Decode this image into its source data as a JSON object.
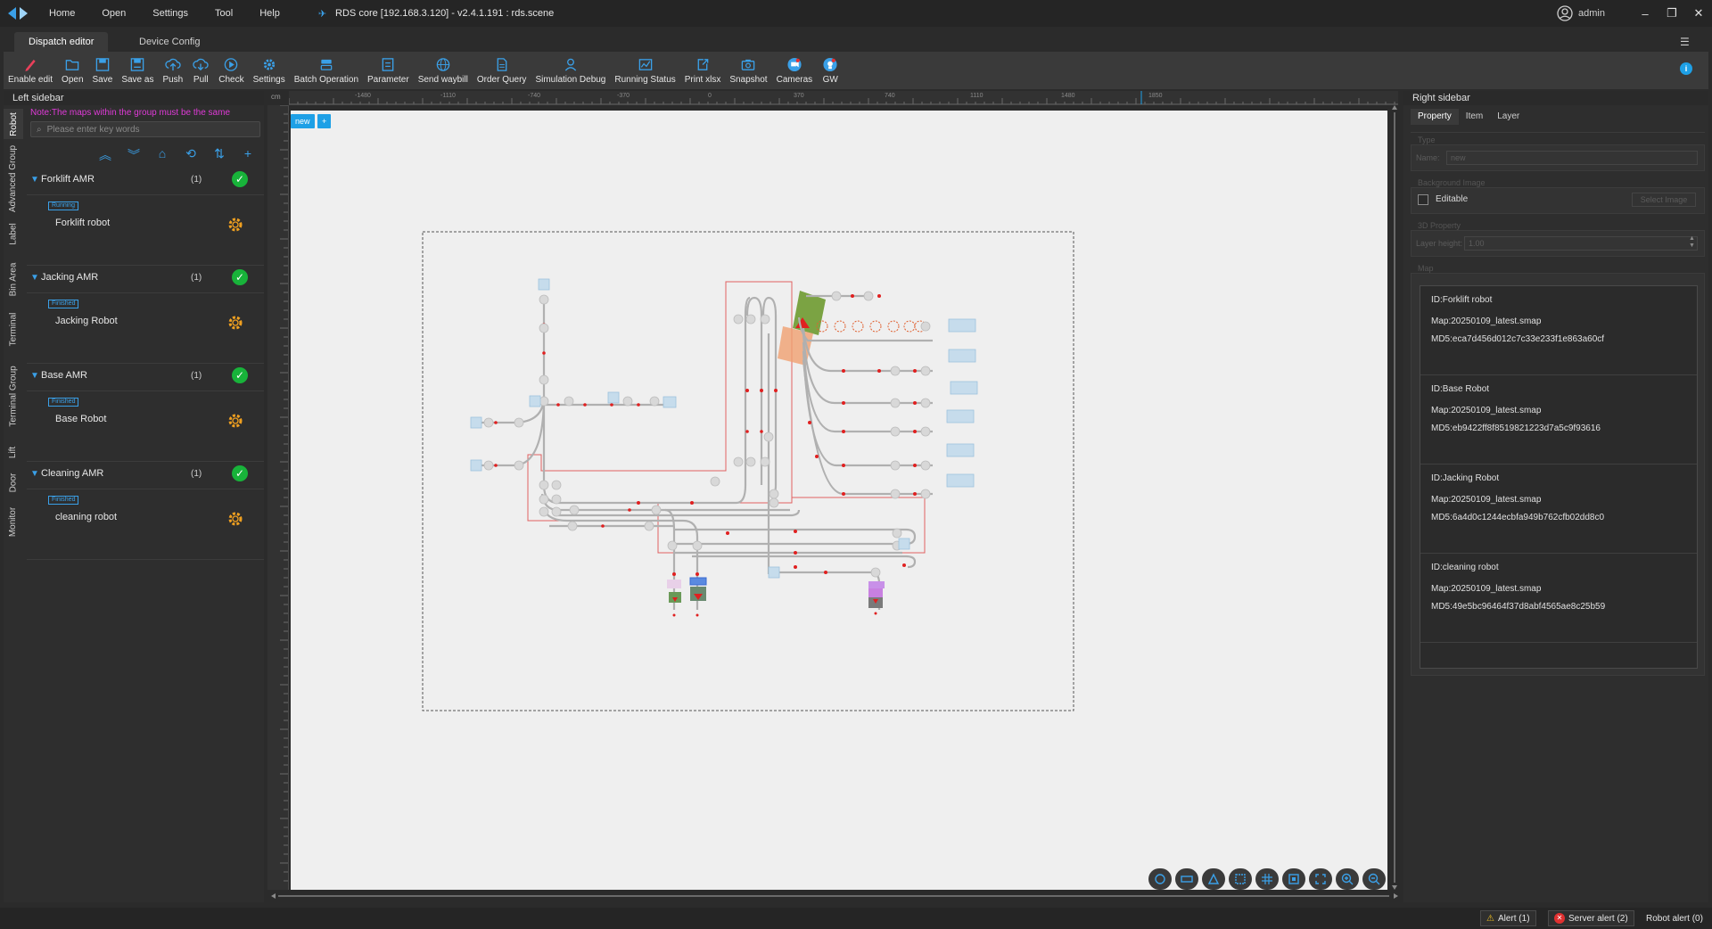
{
  "titlebar": {
    "menus": [
      "Home",
      "Open",
      "Settings",
      "Tool",
      "Help"
    ],
    "app_title": "RDS core [192.168.3.120] - v2.4.1.191 : rds.scene",
    "user": "admin"
  },
  "main_tabs": [
    "Dispatch editor",
    "Device Config"
  ],
  "toolbar": {
    "items": [
      {
        "label": "Enable edit",
        "icon": "pencil-icon"
      },
      {
        "label": "Open",
        "icon": "folder-icon"
      },
      {
        "label": "Save",
        "icon": "save-icon"
      },
      {
        "label": "Save as",
        "icon": "save-as-icon"
      },
      {
        "label": "Push",
        "icon": "cloud-upload-icon"
      },
      {
        "label": "Pull",
        "icon": "cloud-download-icon"
      },
      {
        "label": "Check",
        "icon": "play-circle-icon"
      },
      {
        "label": "Settings",
        "icon": "gear-icon"
      },
      {
        "label": "Batch Operation",
        "icon": "batch-icon"
      },
      {
        "label": "Parameter",
        "icon": "parameter-icon"
      },
      {
        "label": "Send waybill",
        "icon": "globe-icon"
      },
      {
        "label": "Order Query",
        "icon": "document-icon"
      },
      {
        "label": "Simulation Debug",
        "icon": "user-debug-icon"
      },
      {
        "label": "Running Status",
        "icon": "chart-icon"
      },
      {
        "label": "Print xlsx",
        "icon": "export-icon"
      },
      {
        "label": "Snapshot",
        "icon": "camera-icon"
      },
      {
        "label": "Cameras",
        "icon": "cameras-icon"
      },
      {
        "label": "GW",
        "icon": "gw-icon"
      }
    ]
  },
  "left_sidebar": {
    "title": "Left sidebar",
    "vertical_tabs": [
      "Robot",
      "Advanced Group",
      "Label",
      "Bin Area",
      "Terminal",
      "Terminal Group",
      "Lift",
      "Door",
      "Monitor"
    ],
    "note": "Note:The maps within the group must be the same",
    "search_placeholder": "Please enter key words",
    "groups": [
      {
        "name": "Forklift AMR",
        "count": "(1)",
        "status": "Running",
        "robot": "Forklift robot"
      },
      {
        "name": "Jacking AMR",
        "count": "(1)",
        "status": "Finished",
        "robot": "Jacking Robot"
      },
      {
        "name": "Base AMR",
        "count": "(1)",
        "status": "Finished",
        "robot": "Base Robot"
      },
      {
        "name": "Cleaning AMR",
        "count": "(1)",
        "status": "Finished",
        "robot": "cleaning robot"
      }
    ]
  },
  "canvas": {
    "unit": "cm",
    "buttons": [
      "new",
      "+"
    ],
    "ruler_top": [
      "-1480",
      "-1110",
      "-740",
      "-370",
      "0",
      "370",
      "740",
      "1110",
      "1480",
      "1850"
    ]
  },
  "right_sidebar": {
    "title": "Right sidebar",
    "tabs": [
      "Property",
      "Item",
      "Layer"
    ],
    "type_label": "Type",
    "name_label": "Name:",
    "name_value": "new",
    "bg_label": "Background Image",
    "editable_label": "Editable",
    "select_image": "Select Image",
    "property_3d": "3D Property",
    "layer_height_label": "Layer height:",
    "layer_height_value": "1.00",
    "map_label": "Map",
    "maps": [
      {
        "id": "ID:Forklift robot",
        "map": "Map:20250109_latest.smap",
        "md5": "MD5:eca7d456d012c7c33e233f1e863a60cf"
      },
      {
        "id": "ID:Base Robot",
        "map": "Map:20250109_latest.smap",
        "md5": "MD5:eb9422ff8f8519821223d7a5c9f93616"
      },
      {
        "id": "ID:Jacking Robot",
        "map": "Map:20250109_latest.smap",
        "md5": "MD5:6a4d0c1244ecbfa949b762cfb02dd8c0"
      },
      {
        "id": "ID:cleaning robot",
        "map": "Map:20250109_latest.smap",
        "md5": "MD5:49e5bc96464f37d8abf4565ae8c25b59"
      }
    ]
  },
  "statusbar": {
    "alert": "Alert (1)",
    "server_alert": "Server alert (2)",
    "robot_alert": "Robot alert (0)"
  },
  "colors": {
    "accent": "#1ea0e6",
    "ok": "#18b33a",
    "note": "#e03ad8",
    "path_red": "#e02020",
    "gear": "#f0a020"
  }
}
